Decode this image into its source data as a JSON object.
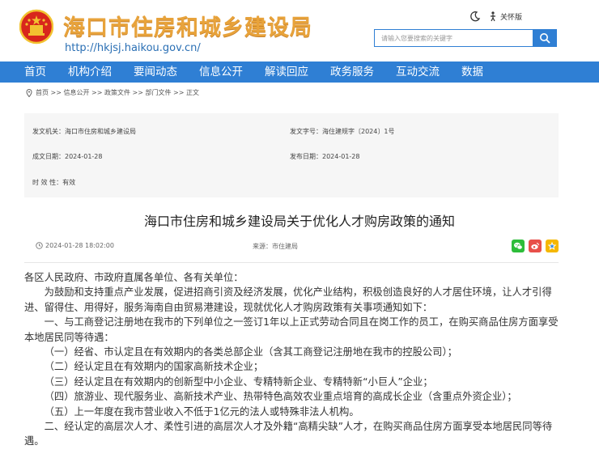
{
  "header": {
    "site_title": "海口市住房和城乡建设局",
    "site_url": "http://hkjsj.haikou.gov.cn/",
    "care_label": "关怀版",
    "search_placeholder": "请输入您要搜索的关键字"
  },
  "nav": {
    "items": [
      "首页",
      "机构介绍",
      "要闻动态",
      "信息公开",
      "解读回应",
      "政务服务",
      "互动交流",
      "数据"
    ]
  },
  "breadcrumb": {
    "text": "首页 >> 信息公开 >> 政策文件 >> 部门文件 >> 正文"
  },
  "meta": {
    "issuer": "发文机关：海口市住房和城乡建设局",
    "doc_number": "发文字号：海住建规字〔2024〕1号",
    "created": "成文日期：2024-01-28",
    "published": "发布日期：2024-01-28",
    "validity": "时 效 性：有效"
  },
  "article": {
    "title": "海口市住房和城乡建设局关于优化人才购房政策的通知",
    "pub_time": "2024-01-28 18:02:00",
    "source": "来源：市住建局",
    "paragraphs": [
      "各区人民政府、市政府直属各单位、各有关单位：",
      "为鼓励和支持重点产业发展，促进招商引资及经济发展，优化产业结构，积极创造良好的人才居住环境，让人才引得进、留得住、用得好，服务海南自由贸易港建设，现就优化人才购房政策有关事项通知如下：",
      "一、与工商登记注册地在我市的下列单位之一签订1年以上正式劳动合同且在岗工作的员工，在购买商品住房方面享受本地居民同等待遇：",
      "（一）经省、市认定且在有效期内的各类总部企业（含其工商登记注册地在我市的控股公司）；",
      "（二）经认定且在有效期内的国家高新技术企业；",
      "（三）经认定且在有效期内的创新型中小企业、专精特新企业、专精特新“小巨人”企业；",
      "（四）旅游业、现代服务业、高新技术产业、热带特色高效农业重点培育的高成长企业（含重点外资企业）；",
      "（五）上一年度在我市营业收入不低于1亿元的法人或特殊非法人机构。",
      "二、经认定的高层次人才、柔性引进的高层次人才及外籍“高精尖缺”人才，在购买商品住房方面享受本地居民同等待遇。"
    ]
  },
  "colors": {
    "nav_blue": "#2f7fd4",
    "title_gold": "#e8a33b",
    "emblem_red": "#d8261c",
    "wechat_green": "#2dbd3a",
    "weibo_red": "#e8504a",
    "qzone_yellow": "#f5b700"
  },
  "icons": [
    "national-emblem-icon",
    "moon-icon",
    "care-mode-icon",
    "search-icon",
    "location-pin-icon",
    "clock-icon",
    "wechat-icon",
    "weibo-icon",
    "qzone-icon"
  ]
}
